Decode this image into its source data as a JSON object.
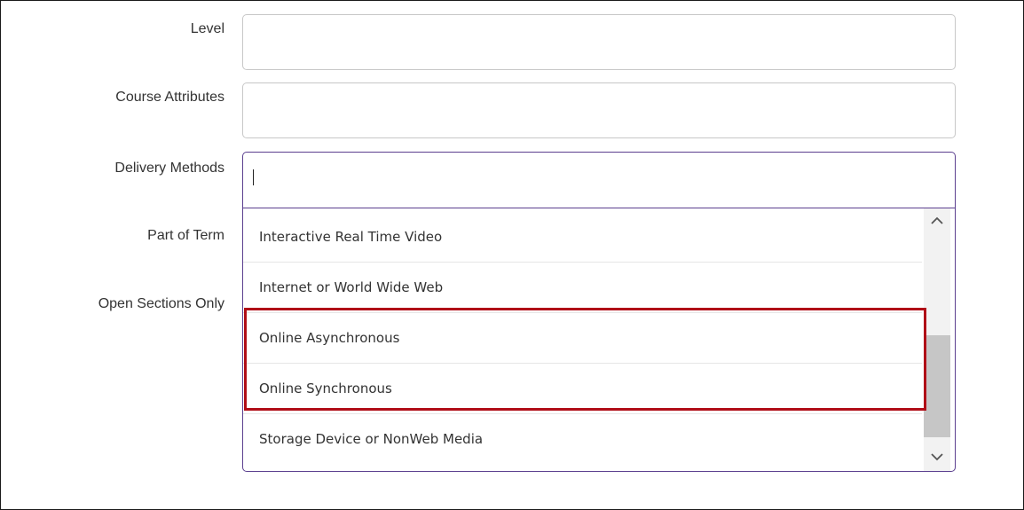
{
  "form": {
    "fields": [
      {
        "label": "Level",
        "value": ""
      },
      {
        "label": "Course Attributes",
        "value": ""
      },
      {
        "label": "Delivery Methods",
        "value": ""
      },
      {
        "label": "Part of Term"
      },
      {
        "label": "Open Sections Only"
      }
    ]
  },
  "delivery_dropdown": {
    "options": [
      "Interactive Real Time Video",
      "Internet or World Wide Web",
      "Online Asynchronous",
      "Online Synchronous",
      "Storage Device or NonWeb Media"
    ],
    "highlight_color": "#b00d17",
    "scrollbar": {
      "up_icon": "chevron-up-icon",
      "down_icon": "chevron-down-icon"
    }
  }
}
